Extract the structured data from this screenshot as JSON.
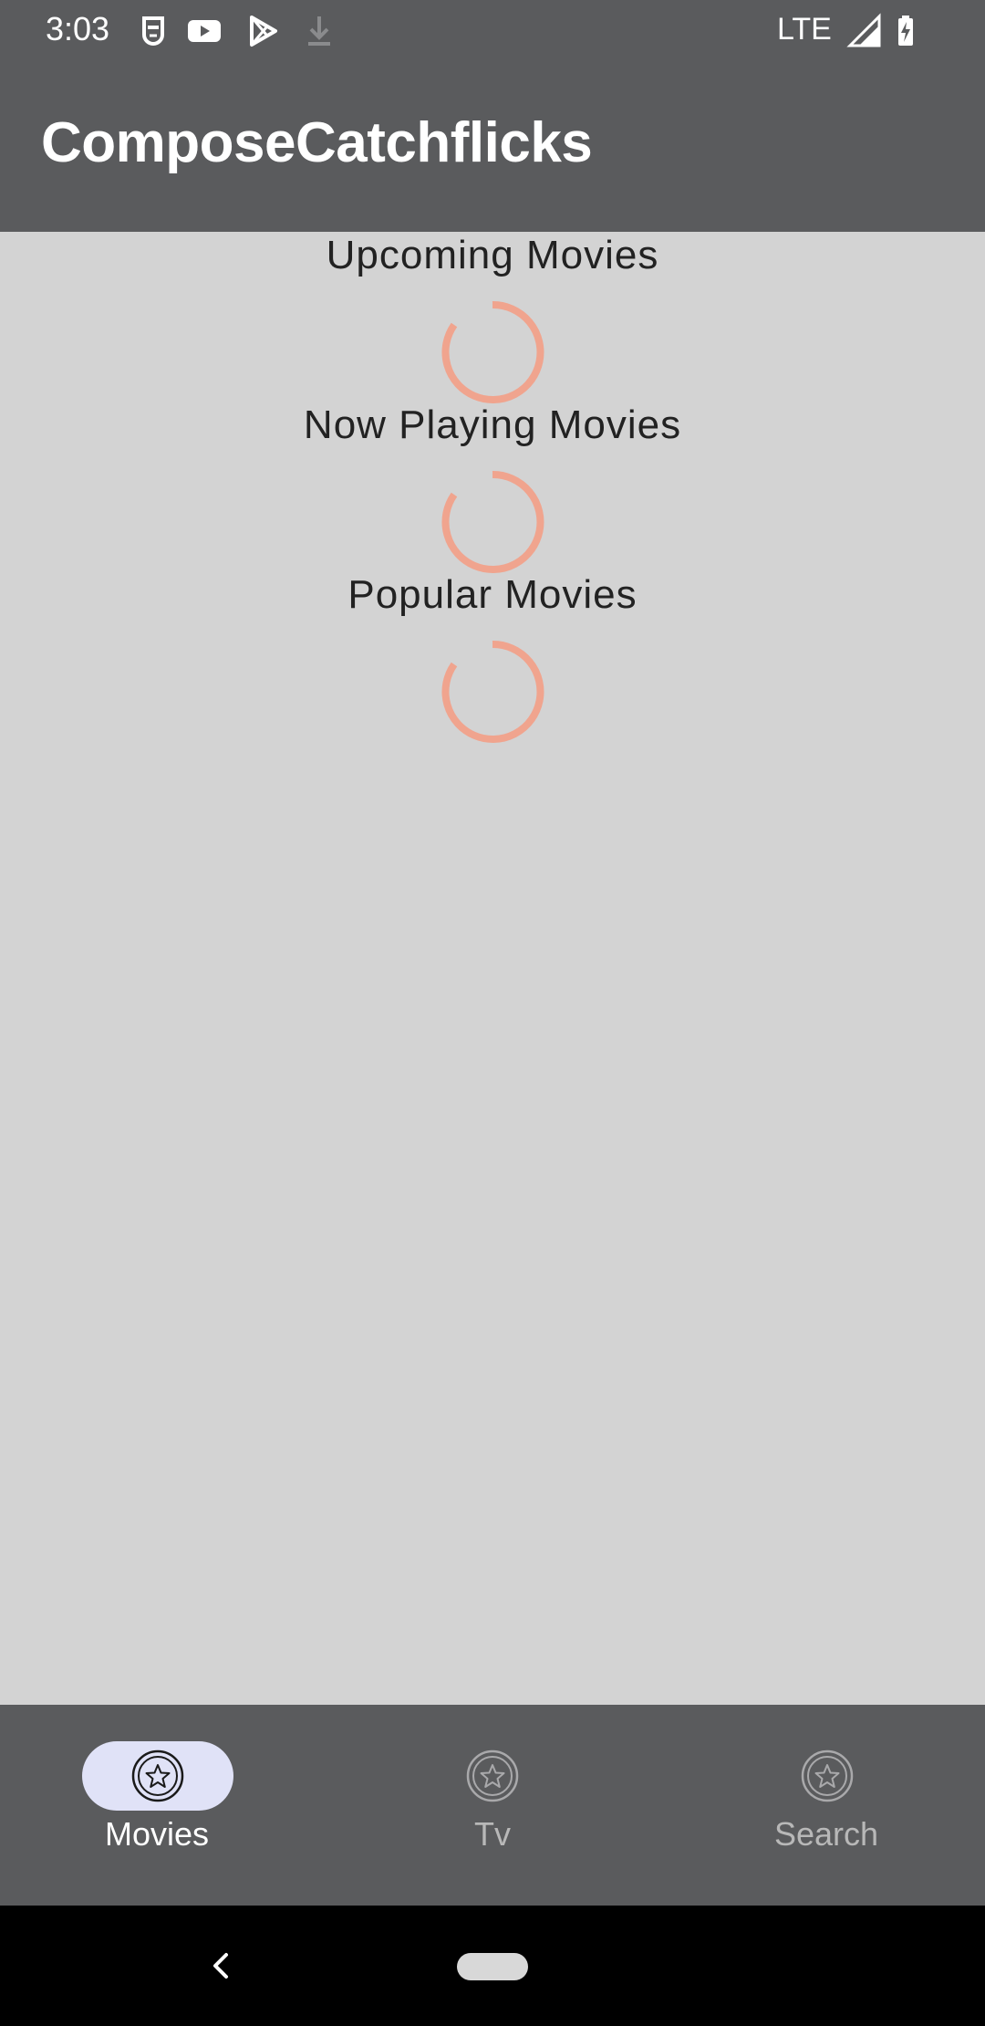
{
  "status_bar": {
    "time": "3:03",
    "network": "LTE",
    "icons": [
      "mask-icon",
      "youtube-icon",
      "play-store-icon",
      "download-icon",
      "signal-icon",
      "battery-charging-icon"
    ]
  },
  "app_bar": {
    "title": "ComposeCatchflicks"
  },
  "sections": [
    {
      "title": "Upcoming Movies",
      "state": "loading"
    },
    {
      "title": "Now Playing Movies",
      "state": "loading"
    },
    {
      "title": "Popular Movies",
      "state": "loading"
    }
  ],
  "bottom_nav": {
    "items": [
      {
        "label": "Movies",
        "icon": "star-circle-icon",
        "selected": true
      },
      {
        "label": "Tv",
        "icon": "star-circle-icon",
        "selected": false
      },
      {
        "label": "Search",
        "icon": "star-circle-icon",
        "selected": false
      }
    ]
  },
  "colors": {
    "bar_background": "#5a5b5d",
    "content_background": "#d3d3d3",
    "spinner": "#f0a48e",
    "selected_pill": "#e0e2f7",
    "selected_label": "#ffffff",
    "unselected_label": "#b8b8b8"
  }
}
